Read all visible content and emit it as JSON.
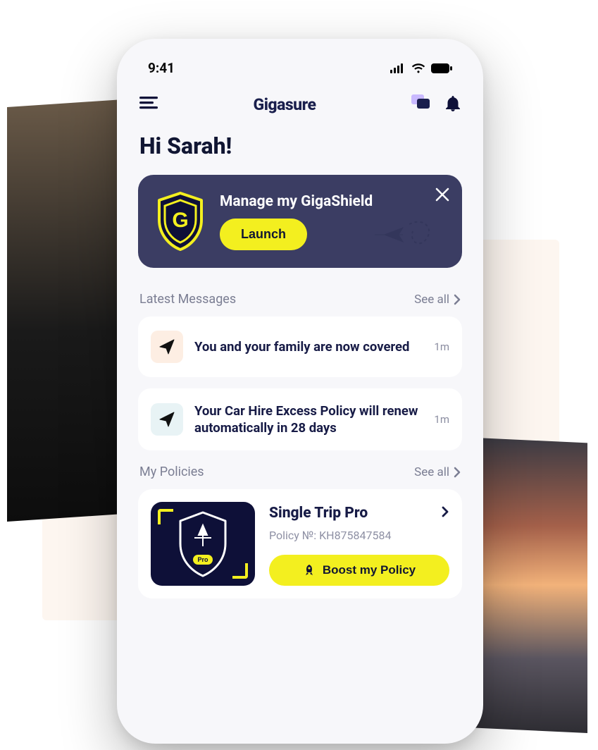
{
  "status": {
    "time": "9:41"
  },
  "topbar": {
    "brand": "Gigasure"
  },
  "greeting": "Hi Sarah!",
  "hero": {
    "title": "Manage my GigaShield",
    "button": "Launch",
    "shield_letter": "G"
  },
  "messages": {
    "section_label": "Latest Messages",
    "see_all": "See all",
    "items": [
      {
        "text": "You and your family are now covered",
        "time": "1m",
        "tint": "warm"
      },
      {
        "text": "Your Car Hire Excess Policy will renew automatically in 28 days",
        "time": "1m",
        "tint": "cool"
      }
    ]
  },
  "policies": {
    "section_label": "My Policies",
    "see_all": "See all",
    "card": {
      "title": "Single Trip Pro",
      "subtitle": "Policy №: KH875847584",
      "badge_tag": "Pro",
      "boost_label": "Boost my Policy"
    }
  },
  "colors": {
    "accent_yellow": "#f3ef1f",
    "dark_navy": "#111633",
    "card_navy": "#3b3d63"
  }
}
